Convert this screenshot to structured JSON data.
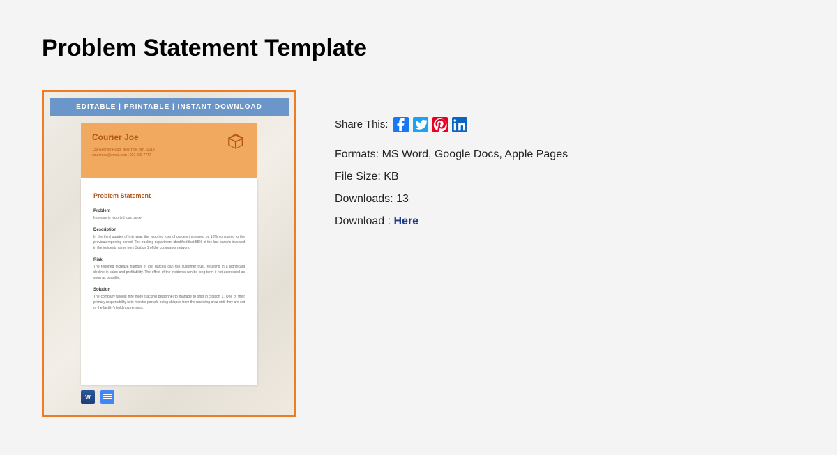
{
  "title": "Problem Statement Template",
  "preview": {
    "banner": "EDITABLE  |  PRINTABLE  |  INSTANT DOWNLOAD",
    "company": "Courier Joe",
    "address": "139 Godfrey Road, New York, NY 10013",
    "contact": "courierjoe@email.com | 222 555 7777",
    "doc_title": "Problem Statement",
    "sections": {
      "problem_h": "Problem",
      "problem_p": "Increase in reported loss parcel",
      "description_h": "Description",
      "description_p": "In the third quarter of this year, the reported loss of parcels increased by 13% compared to the previous reporting period. The tracking department identified that 55% of the lost parcels involved in the incidents came from Station 1 of the company's network.",
      "risk_h": "Risk",
      "risk_p": "The reported increase number of lost parcels can risk customer trust, resulting in a significant decline in sales and profitability. The effect of the incidents can be long-term if not addressed as soon as possible.",
      "solution_h": "Solution",
      "solution_p": "The company should hire more tracking personnel to manage to ship in Station 1. One of their primary responsibility is to monitor parcels being shipped from the receiving area until they are out of the facility's holding premises."
    }
  },
  "meta": {
    "share_label": "Share This:",
    "formats_label": "Formats:",
    "formats_value": "MS Word, Google Docs, Apple Pages",
    "filesize_label": "File Size:",
    "filesize_value": "KB",
    "downloads_label": "Downloads:",
    "downloads_value": "13",
    "download_label": "Download :",
    "download_link": "Here"
  }
}
